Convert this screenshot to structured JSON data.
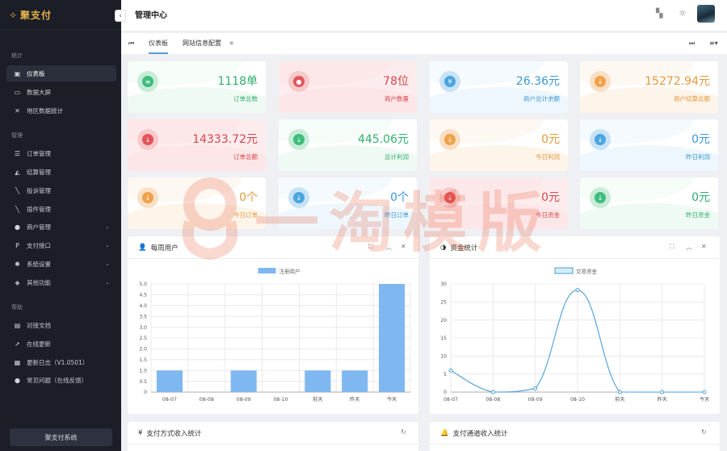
{
  "app": {
    "name": "聚支付"
  },
  "sidebar": {
    "sections": [
      "统计",
      "管理",
      "帮助"
    ],
    "items": [
      {
        "label": "仪表板",
        "icon": "dashboard-icon",
        "glyph": "▣"
      },
      {
        "label": "数据大屏",
        "icon": "screen-icon",
        "glyph": "▭"
      },
      {
        "label": "地区数据统计",
        "icon": "tools-icon",
        "glyph": "✕"
      },
      {
        "label": "订单管理",
        "icon": "list-icon",
        "glyph": "☰"
      },
      {
        "label": "结算管理",
        "icon": "settle-icon",
        "glyph": "◭"
      },
      {
        "label": "投诉管理",
        "icon": "complaint-icon",
        "glyph": "╲"
      },
      {
        "label": "插件管理",
        "icon": "plugin-icon",
        "glyph": "╲"
      },
      {
        "label": "商户管理",
        "icon": "user-icon",
        "glyph": "●"
      },
      {
        "label": "支付接口",
        "icon": "paypal-icon",
        "glyph": "P"
      },
      {
        "label": "系统设置",
        "icon": "gear-icon",
        "glyph": "✺"
      },
      {
        "label": "其他功能",
        "icon": "layers-icon",
        "glyph": "◈"
      },
      {
        "label": "对接文档",
        "icon": "book-icon",
        "glyph": "▤"
      },
      {
        "label": "在线更新",
        "icon": "rocket-icon",
        "glyph": "➚"
      },
      {
        "label": "更新日志（V1.0501）",
        "icon": "log-icon",
        "glyph": "▦"
      },
      {
        "label": "常见问题（在线反馈）",
        "icon": "feedback-icon",
        "glyph": "●"
      }
    ],
    "footer_button": "聚支付系统"
  },
  "header": {
    "title": "管理中心"
  },
  "tabs": [
    {
      "label": "仪表板"
    },
    {
      "label": "网站信息配置"
    }
  ],
  "stats": [
    {
      "value": "1118单",
      "label": "订单总数",
      "color": "green",
      "icon": "list-icon",
      "glyph": "≡"
    },
    {
      "value": "78位",
      "label": "商户数量",
      "color": "red",
      "icon": "user-icon",
      "glyph": "●"
    },
    {
      "value": "26.36元",
      "label": "商户总计余额",
      "color": "blue",
      "icon": "yen-icon",
      "glyph": "¥"
    },
    {
      "value": "15272.94元",
      "label": "商户结算总额",
      "color": "orange",
      "icon": "arrow-down-icon",
      "glyph": "↓"
    },
    {
      "value": "14333.72元",
      "label": "订单总额",
      "color": "red",
      "icon": "arrow-down-icon",
      "glyph": "↓"
    },
    {
      "value": "445.06元",
      "label": "总计利润",
      "color": "green",
      "icon": "arrow-down-icon",
      "glyph": "↓"
    },
    {
      "value": "0元",
      "label": "今日利润",
      "color": "orange",
      "icon": "arrow-down-icon",
      "glyph": "↓"
    },
    {
      "value": "0元",
      "label": "昨日利润",
      "color": "blue",
      "icon": "arrow-down-icon",
      "glyph": "↓"
    },
    {
      "value": "0个",
      "label": "今日订单",
      "color": "orange",
      "icon": "arrow-down-icon",
      "glyph": "↓"
    },
    {
      "value": "0个",
      "label": "昨日订单",
      "color": "blue",
      "icon": "arrow-down-icon",
      "glyph": "↓"
    },
    {
      "value": "0元",
      "label": "今日资金",
      "color": "red",
      "icon": "arrow-down-icon",
      "glyph": "↓"
    },
    {
      "value": "0元",
      "label": "昨日资金",
      "color": "green",
      "icon": "arrow-down-icon",
      "glyph": "↓"
    }
  ],
  "panels": {
    "users": {
      "title": "每周用户"
    },
    "funds": {
      "title": "资金统计"
    },
    "pay_method": {
      "title": "支付方式收入统计"
    },
    "pay_channel": {
      "title": "支付通道收入统计"
    }
  },
  "chart_data": [
    {
      "type": "bar",
      "categories": [
        "08-07",
        "08-08",
        "08-09",
        "08-10",
        "前天",
        "昨天",
        "今天"
      ],
      "series": [
        {
          "name": "注册用户",
          "values": [
            1,
            0,
            1,
            0,
            1,
            1,
            5
          ],
          "color": "#7fb8f0"
        }
      ],
      "ylim": [
        0,
        5
      ],
      "yticks": [
        "0",
        "0.5",
        "1.0",
        "1.5",
        "2.0",
        "2.5",
        "3.0",
        "3.5",
        "4.0",
        "4.5",
        "5.0"
      ],
      "legend": "top-center",
      "grid": true
    },
    {
      "type": "line",
      "categories": [
        "08-07",
        "08-08",
        "08-09",
        "08-10",
        "前天",
        "昨天",
        "今天"
      ],
      "series": [
        {
          "name": "交易资金",
          "values": [
            6,
            0,
            1,
            28.3,
            0,
            0,
            0
          ],
          "color": "#4a9fd8"
        }
      ],
      "ylim": [
        0,
        30
      ],
      "yticks": [
        "0",
        "5",
        "10",
        "15",
        "20",
        "25",
        "30"
      ],
      "legend": "top-center",
      "grid": true
    }
  ],
  "watermark": {
    "text": "一淘模版"
  }
}
